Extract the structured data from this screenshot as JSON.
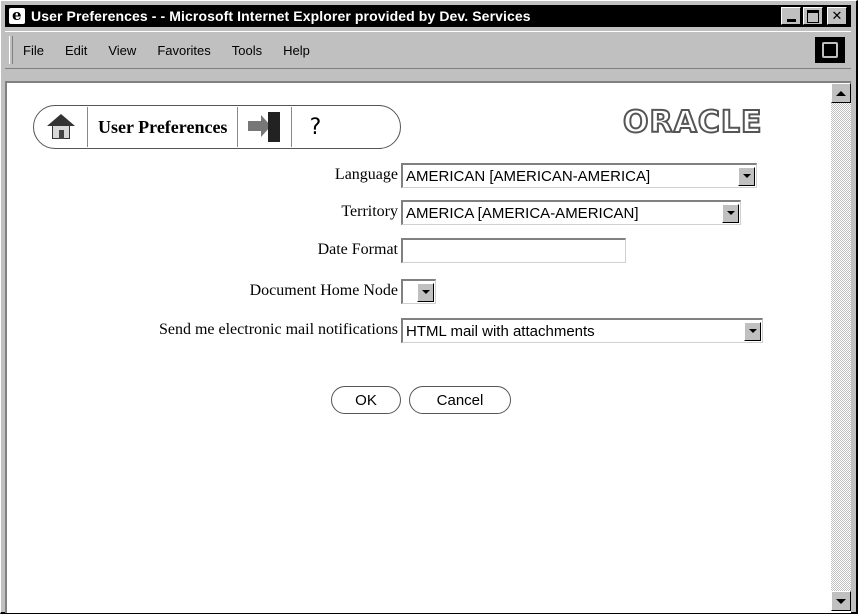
{
  "window": {
    "title": "User Preferences - - Microsoft Internet Explorer provided by Dev. Services",
    "icon": "ie-icon"
  },
  "menubar": {
    "items": [
      {
        "label": "File"
      },
      {
        "label": "Edit"
      },
      {
        "label": "View"
      },
      {
        "label": "Favorites"
      },
      {
        "label": "Tools"
      },
      {
        "label": "Help"
      }
    ]
  },
  "toolbar": {
    "title": "User Preferences",
    "help_label": "?",
    "home_icon": "home-icon",
    "exit_icon": "exit-icon"
  },
  "brand": {
    "logo_text": "ORACLE"
  },
  "form": {
    "language": {
      "label": "Language",
      "value": "AMERICAN [AMERICAN-AMERICA]"
    },
    "territory": {
      "label": "Territory",
      "value": "AMERICA [AMERICA-AMERICAN]"
    },
    "date_format": {
      "label": "Date Format",
      "value": ""
    },
    "document_home_node": {
      "label": "Document Home Node",
      "value": ""
    },
    "mail_notifications": {
      "label": "Send me electronic mail notifications",
      "value": "HTML mail with attachments"
    }
  },
  "buttons": {
    "ok": "OK",
    "cancel": "Cancel"
  }
}
